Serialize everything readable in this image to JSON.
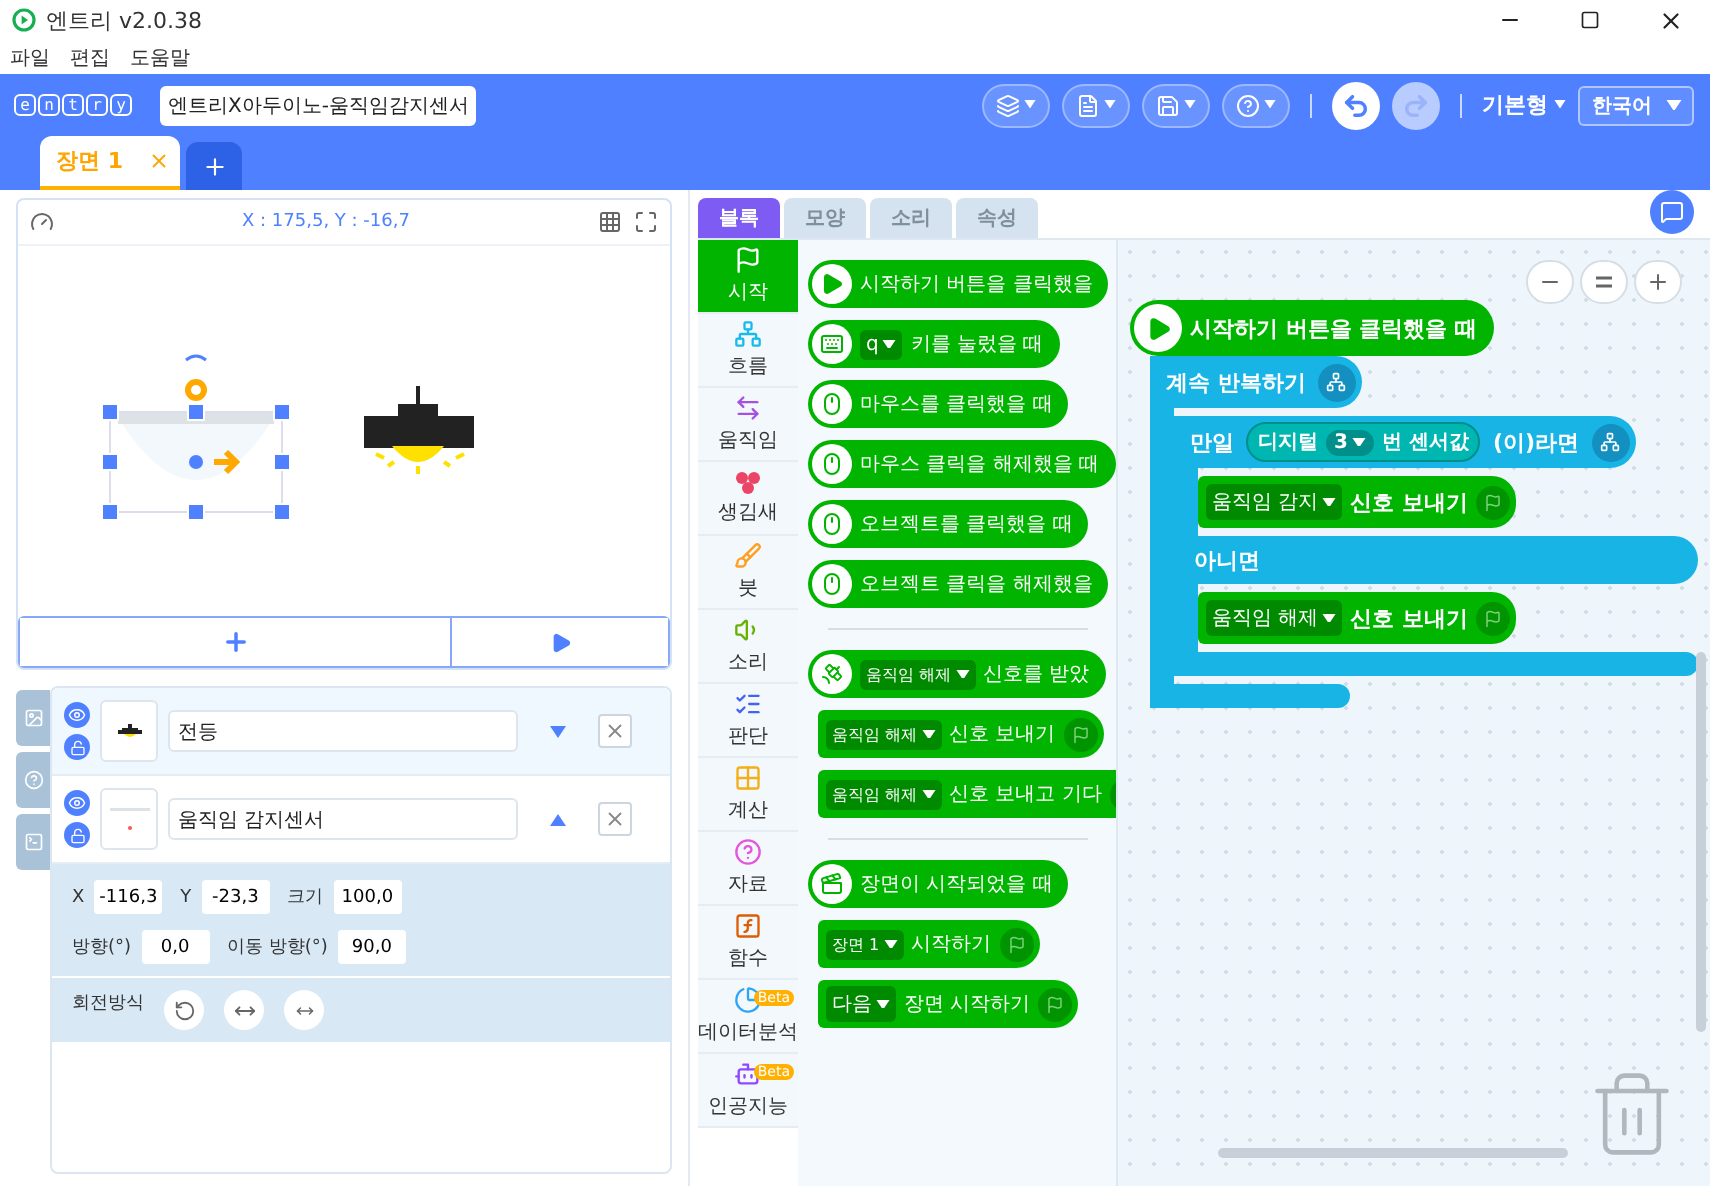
{
  "window": {
    "title": "엔트리 v2.0.38"
  },
  "menu": [
    "파일",
    "편집",
    "도움말"
  ],
  "header": {
    "logo": [
      "e",
      "n",
      "t",
      "r",
      "y"
    ],
    "project_title": "엔트리X아두이노-움직임감지센서",
    "mode": "기본형",
    "language": "한국어"
  },
  "scenes": [
    {
      "label": "장면 1",
      "selected": true
    }
  ],
  "stage": {
    "coordinates": "X : 175,5, Y : -16,7"
  },
  "objects": [
    {
      "name": "전등",
      "selected": true,
      "expanded": false
    },
    {
      "name": "움직임 감지센서",
      "selected": false,
      "expanded": true
    }
  ],
  "properties": {
    "fields": [
      {
        "label": "X",
        "value": "-116,3"
      },
      {
        "label": "Y",
        "value": "-23,3"
      },
      {
        "label": "크기",
        "value": "100,0"
      },
      {
        "label": "방향(°)",
        "value": "0,0"
      },
      {
        "label": "이동 방향(°)",
        "value": "90,0"
      }
    ],
    "rotation_label": "회전방식"
  },
  "block_tabs": [
    {
      "label": "블록",
      "selected": true
    },
    {
      "label": "모양",
      "selected": false
    },
    {
      "label": "소리",
      "selected": false
    },
    {
      "label": "속성",
      "selected": false
    }
  ],
  "categories": [
    {
      "label": "시작",
      "selected": true,
      "color": "#00b400"
    },
    {
      "label": "흐름",
      "selected": false,
      "color": "#19baea"
    },
    {
      "label": "움직임",
      "selected": false,
      "color": "#a751e3"
    },
    {
      "label": "생김새",
      "selected": false,
      "color": "#ec4466"
    },
    {
      "label": "붓",
      "selected": false,
      "color": "#ff9e20"
    },
    {
      "label": "소리",
      "selected": false,
      "color": "#67b100"
    },
    {
      "label": "판단",
      "selected": false,
      "color": "#4562f5"
    },
    {
      "label": "계산",
      "selected": false,
      "color": "#f4af18"
    },
    {
      "label": "자료",
      "selected": false,
      "color": "#e457dc"
    },
    {
      "label": "함수",
      "selected": false,
      "color": "#de5c04"
    },
    {
      "label": "데이터분석",
      "selected": false,
      "color": "#2fa5f5",
      "badge": "Beta"
    },
    {
      "label": "인공지능",
      "selected": false,
      "color": "#8f49ff",
      "badge": "Beta"
    }
  ],
  "palette": [
    [
      {
        "kind": "start",
        "text": "시작하기 버튼을 클릭했을"
      },
      {
        "kind": "key",
        "dropdown": "q",
        "text": "키를 눌렀을 때"
      },
      {
        "kind": "mouse",
        "text": "마우스를 클릭했을 때"
      },
      {
        "kind": "mouse",
        "text": "마우스 클릭을 해제했을 때"
      },
      {
        "kind": "mouse",
        "text": "오브젝트를 클릭했을 때"
      },
      {
        "kind": "mouse",
        "text": "오브젝트 클릭을 해제했을"
      }
    ],
    [
      {
        "kind": "signal",
        "dropdown": "움직임 해제",
        "text": "신호를 받았"
      },
      {
        "kind": "command",
        "dropdown": "움직임 해제",
        "text": "신호 보내기"
      },
      {
        "kind": "command",
        "dropdown": "움직임 해제",
        "text": "신호 보내고 기다"
      }
    ],
    [
      {
        "kind": "scene",
        "text": "장면이 시작되었을 때"
      },
      {
        "kind": "command",
        "dropdown": "장면 1",
        "text": "시작하기"
      },
      {
        "kind": "command",
        "dropdown": "다음",
        "text": "장면 시작하기"
      }
    ]
  ],
  "script": {
    "trigger": "시작하기 버튼을 클릭했을 때",
    "loop": "계속 반복하기",
    "if": {
      "label": "만일",
      "sensor": {
        "label": "디지털",
        "pin": "3",
        "suffix": "번 센서값"
      },
      "then_label": "(이)라면",
      "else_label": "아니면"
    },
    "then": {
      "signal": "움직임 감지",
      "action": "신호 보내기"
    },
    "else": {
      "signal": "움직임 해제",
      "action": "신호 보내기"
    }
  }
}
